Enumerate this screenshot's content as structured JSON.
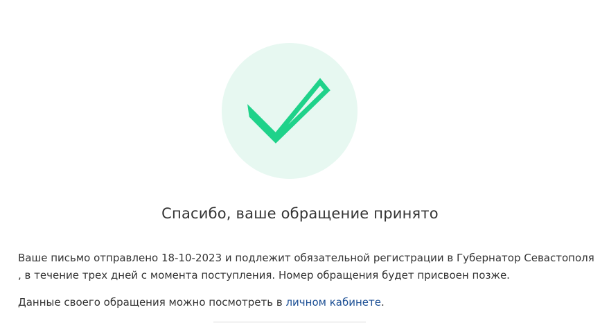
{
  "confirmation": {
    "icon": "checkmark-icon",
    "colors": {
      "circle_background": "#e7f8f1",
      "checkmark": "#1fd28a",
      "link": "#1c4f94"
    },
    "title": "Спасибо, ваше обращение принято",
    "message_line1": "Ваше письмо отправлено 18-10-2023 и подлежит обязательной регистрации в Губернатор Севастополя",
    "message_line2": ", в течение трех дней с момента поступления. Номер обращения будет присвоен позже.",
    "cabinet_text": "Данные своего обращения можно посмотреть в ",
    "cabinet_link": "личном кабинете",
    "cabinet_suffix": "."
  }
}
